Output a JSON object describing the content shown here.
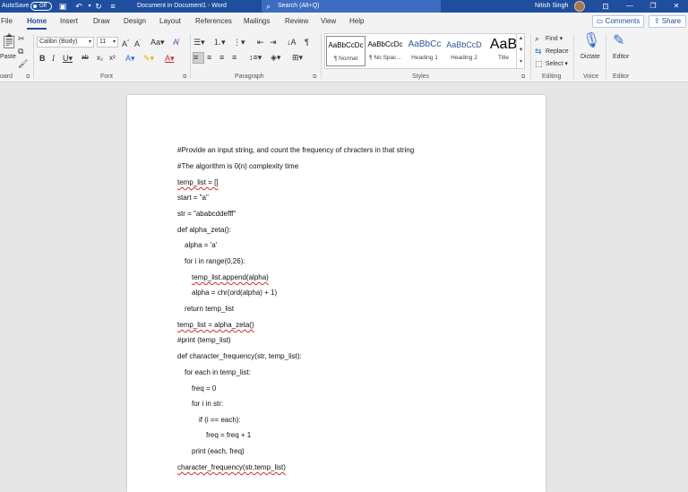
{
  "titlebar": {
    "autosave_label": "AutoSave",
    "autosave_state": "Off",
    "doc_title": "Document in Document1  -  Word",
    "search_placeholder": "Search (Alt+Q)",
    "user_name": "Nitish Singh",
    "window_controls": [
      "—",
      "❐",
      "✕"
    ]
  },
  "tabs": [
    "File",
    "Home",
    "Insert",
    "Draw",
    "Design",
    "Layout",
    "References",
    "Mailings",
    "Review",
    "View",
    "Help"
  ],
  "active_tab": "Home",
  "actions": {
    "comments": "Comments",
    "share": "Share"
  },
  "ribbon": {
    "clipboard": {
      "paste": "Paste",
      "label": "Clipboard"
    },
    "font": {
      "name": "Calibri (Body)",
      "size": "11",
      "label": "Font"
    },
    "paragraph": {
      "label": "Paragraph"
    },
    "styles": {
      "label": "Styles",
      "items": [
        {
          "preview": "AaBbCcDc",
          "name": "¶ Normal"
        },
        {
          "preview": "AaBbCcDc",
          "name": "¶ No Spac..."
        },
        {
          "preview": "AaBbCc",
          "name": "Heading 1"
        },
        {
          "preview": "AaBbCcD",
          "name": "Heading 2"
        },
        {
          "preview": "AaB",
          "name": "Title"
        }
      ]
    },
    "editing": {
      "find": "Find",
      "replace": "Replace",
      "select": "Select",
      "label": "Editing"
    },
    "voice": {
      "dictate": "Dictate",
      "label": "Voice"
    },
    "editor": {
      "editor": "Editor",
      "label": "Editor"
    }
  },
  "document": {
    "lines": [
      "#Provide an input string, and count the frequency of chracters in that string",
      "#The algorithm is 0(n) complexity time",
      "temp_list = []",
      "start = \"a\"",
      "str = \"ababcddefff\"",
      "def alpha_zeta():",
      "alpha = 'a'",
      "for i in range(0,26):",
      "temp_list.append(alpha)",
      "alpha = chr(ord(alpha) + 1)",
      "return temp_list",
      "temp_list = alpha_zeta()",
      "#print (temp_list)",
      "def character_frequency(str, temp_list):",
      "for each in temp_list:",
      "freq = 0",
      "for i in str:",
      "if (i == each):",
      "freq = freq + 1",
      "print (each, freq)",
      "character_frequency(str,temp_list)"
    ]
  },
  "colors": {
    "accent": "#1f4e9e",
    "spellcheck": "#d42c2c"
  }
}
